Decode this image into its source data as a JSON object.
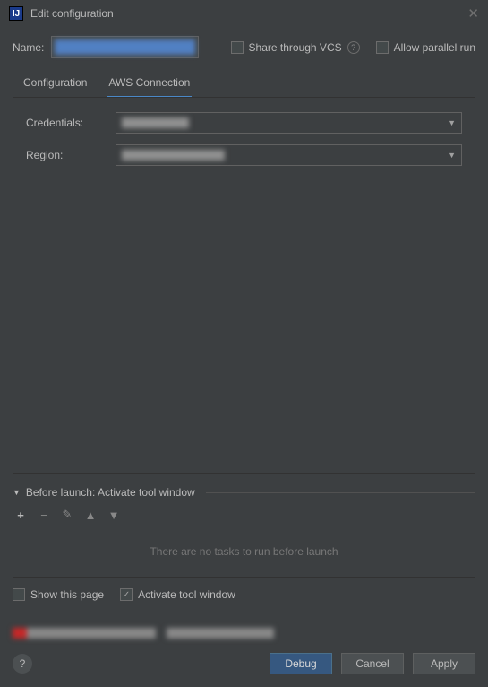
{
  "window": {
    "title": "Edit configuration"
  },
  "name": {
    "label": "Name:",
    "value": ""
  },
  "options": {
    "share_vcs": "Share through VCS",
    "allow_parallel": "Allow parallel run"
  },
  "tabs": {
    "configuration": "Configuration",
    "aws_connection": "AWS Connection"
  },
  "form": {
    "credentials_label": "Credentials:",
    "credentials_value": "",
    "region_label": "Region:",
    "region_value": ""
  },
  "before_launch": {
    "title": "Before launch: Activate tool window",
    "empty": "There are no tasks to run before launch",
    "show_page": "Show this page",
    "activate_tool": "Activate tool window"
  },
  "buttons": {
    "debug": "Debug",
    "cancel": "Cancel",
    "apply": "Apply"
  }
}
